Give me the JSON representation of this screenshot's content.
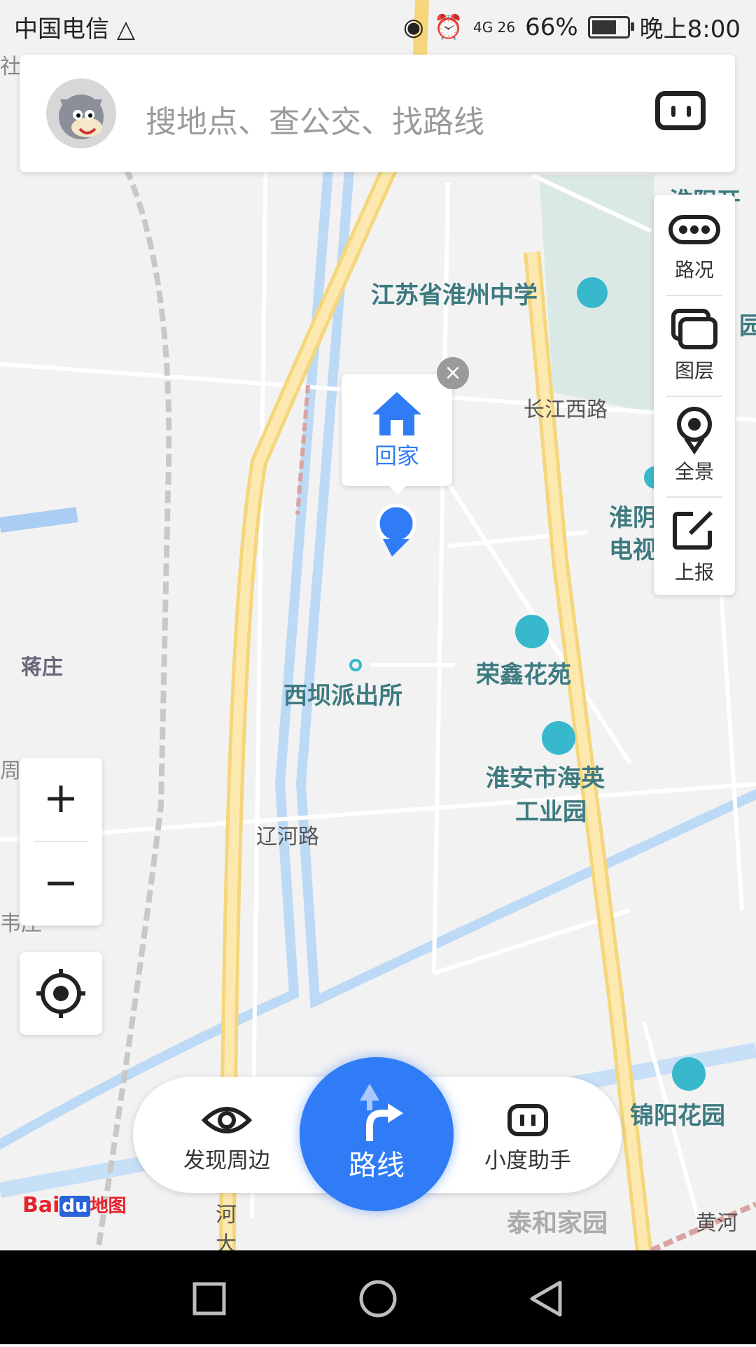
{
  "status_bar": {
    "carrier": "中国电信",
    "network": "4G 26",
    "battery": "66%",
    "battery_level": 0.66,
    "time": "晚上8:00"
  },
  "search": {
    "placeholder": "搜地点、查公交、找路线"
  },
  "right_panel": {
    "items": [
      {
        "label": "路况",
        "icon": "traffic-icon"
      },
      {
        "label": "图层",
        "icon": "layers-icon"
      },
      {
        "label": "全景",
        "icon": "panorama-icon"
      },
      {
        "label": "上报",
        "icon": "report-icon"
      }
    ]
  },
  "popup": {
    "label": "回家",
    "close": "×"
  },
  "zoom": {
    "in": "+",
    "out": "−"
  },
  "bottom_bar": {
    "discover": "发现周边",
    "route": "路线",
    "assistant": "小度助手"
  },
  "logo": {
    "bai": "Bai",
    "du": "du",
    "map": "地图"
  },
  "map_labels": {
    "school": "江苏省淮州中学",
    "changjiang_road": "长江西路",
    "huaiyin": "淮阴",
    "tv": "电视",
    "jiangzhuang": "蒋庄",
    "police": "西坝派出所",
    "rongxin": "荣鑫花苑",
    "haiying_1": "淮安市海英",
    "haiying_2": "工业园",
    "liaohe_road": "辽河路",
    "jinyang": "锦阳花园",
    "taihe": "泰和家园",
    "huanghe": "黄河",
    "he": "河",
    "da": "大",
    "zhou": "周",
    "wei": "韦庄",
    "she": "社",
    "huaiyang": "淮阳开",
    "yuan": "园"
  }
}
